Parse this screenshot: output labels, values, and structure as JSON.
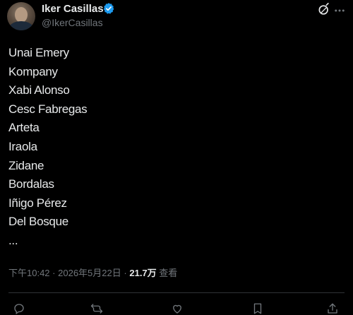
{
  "user": {
    "display_name": "Iker Casillas",
    "handle": "@IkerCasillas"
  },
  "tweet": {
    "lines": [
      "Unai Emery",
      "Kompany",
      "Xabi Alonso",
      "Cesc Fabregas",
      "Arteta",
      "Iraola",
      "Zidane",
      "Bordalas",
      "Iñigo Pérez",
      "Del Bosque",
      "..."
    ],
    "time": "下午10:42",
    "date": "2026年5月22日",
    "views_count": "21.7万",
    "views_label": "查看",
    "separator": "·"
  },
  "icons": {
    "verified": "verified-badge-icon",
    "grok": "grok-icon",
    "more": "more-icon",
    "reply": "reply-icon",
    "repost": "repost-icon",
    "like": "like-icon",
    "bookmark": "bookmark-icon",
    "share": "share-icon"
  },
  "colors": {
    "background": "#000000",
    "text_primary": "#e7e9ea",
    "text_secondary": "#71767b",
    "verified_blue": "#1d9bf0",
    "divider": "#2f3336"
  }
}
